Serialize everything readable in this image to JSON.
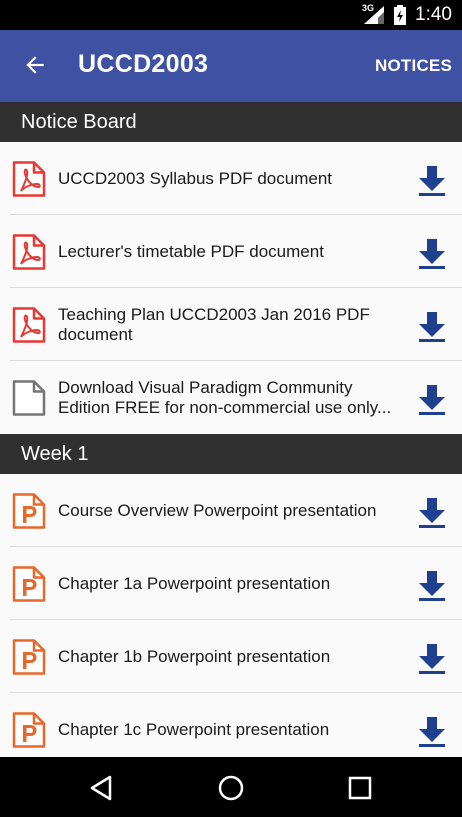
{
  "status_bar": {
    "network": "3G",
    "time": "1:40"
  },
  "app_bar": {
    "title": "UCCD2003",
    "action": "NOTICES"
  },
  "sections": [
    {
      "title": "Notice Board",
      "items": [
        {
          "label": "UCCD2003 Syllabus PDF document",
          "icon": "pdf-icon"
        },
        {
          "label": "Lecturer's timetable PDF document",
          "icon": "pdf-icon"
        },
        {
          "label": "Teaching Plan UCCD2003 Jan 2016 PDF document",
          "icon": "pdf-icon"
        },
        {
          "label": "Download Visual Paradigm Community Edition FREE for non-commercial use only...",
          "icon": "file-icon"
        }
      ]
    },
    {
      "title": "Week 1",
      "items": [
        {
          "label": "Course Overview Powerpoint presentation",
          "icon": "powerpoint-icon"
        },
        {
          "label": "Chapter 1a Powerpoint presentation",
          "icon": "powerpoint-icon"
        },
        {
          "label": "Chapter 1b Powerpoint presentation",
          "icon": "powerpoint-icon"
        },
        {
          "label": "Chapter 1c Powerpoint presentation",
          "icon": "powerpoint-icon"
        }
      ]
    }
  ],
  "colors": {
    "app_bar": "#3f51a3",
    "section_header": "#303030",
    "download_icon": "#1f3f8f",
    "pdf_icon": "#e53935",
    "ppt_icon": "#e8672a",
    "file_icon": "#757575"
  }
}
